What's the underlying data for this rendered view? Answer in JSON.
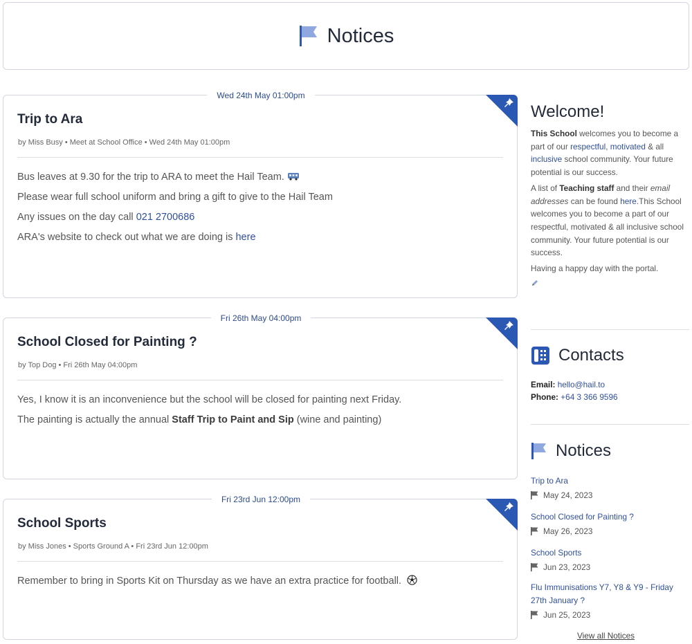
{
  "header": {
    "title": "Notices"
  },
  "notices": [
    {
      "date_pill": "Wed 24th May 01:00pm",
      "title": "Trip to Ara",
      "meta": "by Miss Busy • Meet at School Office • Wed 24th May 01:00pm",
      "line1": "Bus leaves at 9.30 for the trip to ARA to meet the Hail Team.",
      "line2": "Please wear full school uniform and bring a gift to give to the Hail Team",
      "line3_prefix": "Any issues on the day call ",
      "line3_phone": "021 2700686",
      "line4_prefix": "ARA's website to check out what we are doing is ",
      "line4_link": "here"
    },
    {
      "date_pill": "Fri 26th May 04:00pm",
      "title": "School Closed for Painting  ?",
      "meta": "by Top Dog • Fri 26th May 04:00pm",
      "line1": "Yes, I know it is an inconvenience but the school will be closed for painting next Friday.",
      "line2_prefix": "The painting is actually the annual ",
      "line2_bold": "Staff Trip to Paint and Sip",
      "line2_suffix": " (wine and painting)"
    },
    {
      "date_pill": "Fri 23rd Jun 12:00pm",
      "title": "School Sports",
      "meta": "by Miss Jones • Sports Ground A • Fri 23rd Jun 12:00pm",
      "line1": "Remember to bring in Sports Kit on Thursday as we have an extra practice for football."
    }
  ],
  "sidebar": {
    "welcome": {
      "title": "Welcome!",
      "p1_bold": "This School",
      "p1_a": " welcomes you to become a part of our ",
      "p1_link1": "respectful",
      "p1_b": ", ",
      "p1_link2": "motivated",
      "p1_c": " & all ",
      "p1_link3": "inclusive",
      "p1_d": " school community. Your future potential is our success.",
      "p2_a": "A list of ",
      "p2_bold": "Teaching staff",
      "p2_b": " and their ",
      "p2_italic": "email addresses",
      "p2_c": " can be found ",
      "p2_link": "here",
      "p2_d": ".This School welcomes you to become a part of our respectful, motivated & all inclusive school community. Your future potential is our success.",
      "p3": "Having a happy day with the portal."
    },
    "contacts": {
      "title": "Contacts",
      "email_label": "Email:",
      "email": "hello@hail.to",
      "phone_label": "Phone:",
      "phone": "+64 3 366 9596"
    },
    "notices": {
      "title": "Notices",
      "items": [
        {
          "title": "Trip to Ara",
          "date": "May 24, 2023"
        },
        {
          "title": "School Closed for Painting  ?",
          "date": "May 26, 2023"
        },
        {
          "title": "School Sports",
          "date": "Jun 23, 2023"
        },
        {
          "title": "Flu Immunisations Y7, Y8 & Y9 - Friday 27th January ?",
          "date": "Jun 25, 2023"
        }
      ],
      "view_all": "View all Notices"
    }
  },
  "colors": {
    "accent": "#2a58b3",
    "link": "#2f4f9e",
    "flag_light": "#8fa8df"
  }
}
